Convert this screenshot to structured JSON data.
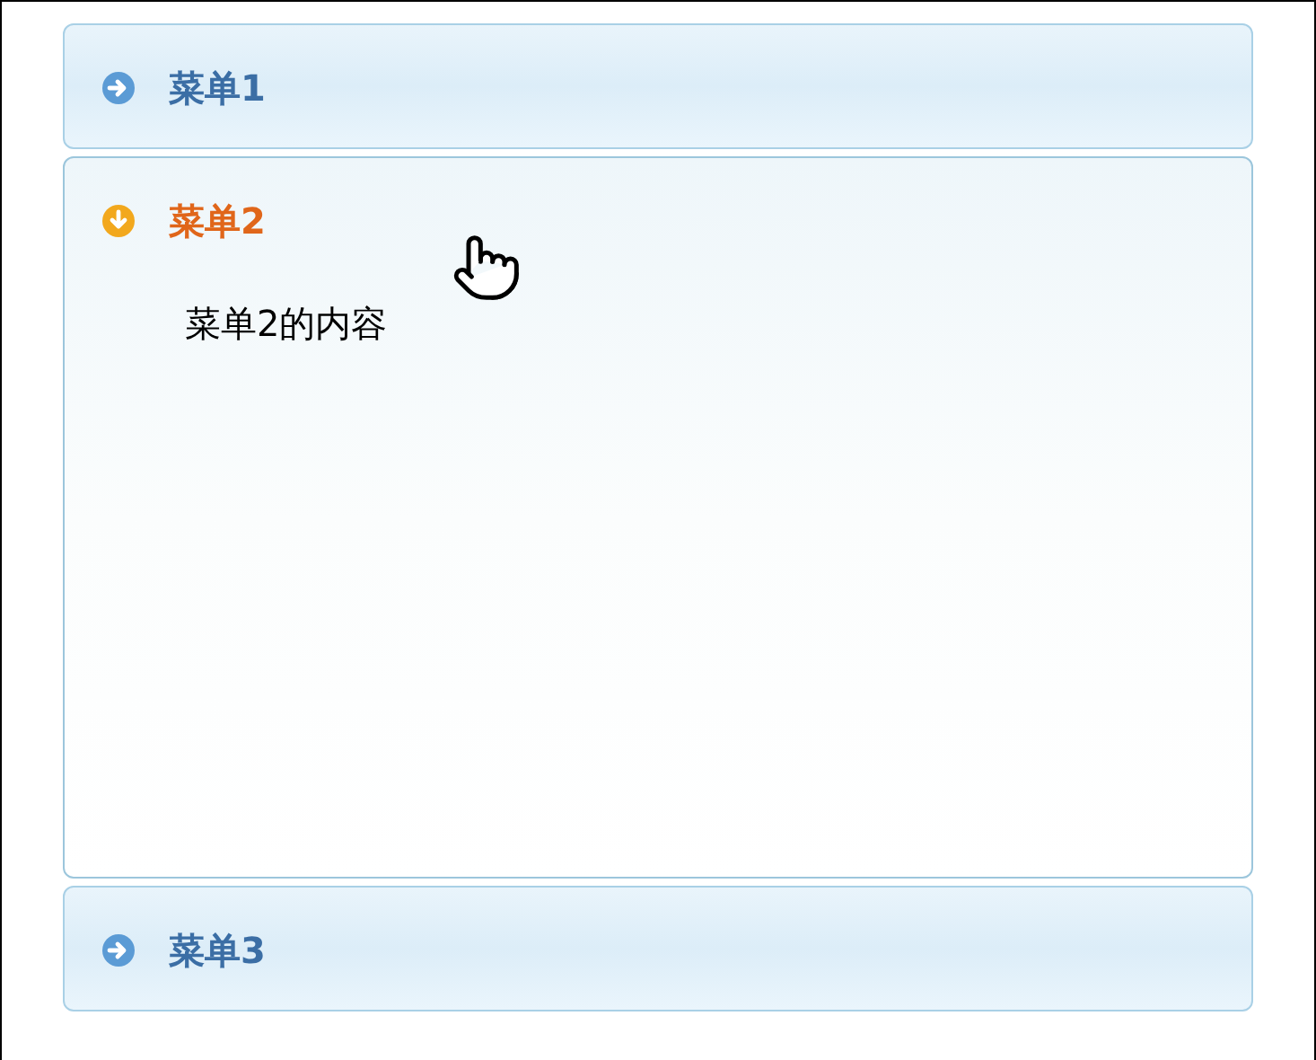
{
  "menus": [
    {
      "title": "菜单1",
      "expanded": false
    },
    {
      "title": "菜单2",
      "expanded": true,
      "content": "菜单2的内容"
    },
    {
      "title": "菜单3",
      "expanded": false
    }
  ]
}
